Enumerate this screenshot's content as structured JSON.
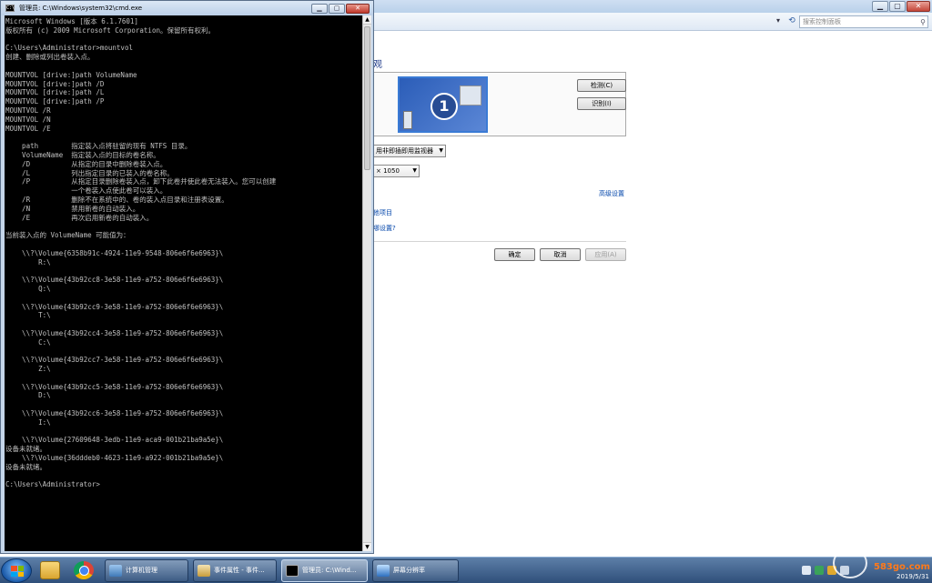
{
  "cmd_window": {
    "title": "管理员: C:\\Windows\\system32\\cmd.exe",
    "icon_label": "C:\\",
    "output_lines": [
      "Microsoft Windows [版本 6.1.7601]",
      "版权所有 (c) 2009 Microsoft Corporation。保留所有权利。",
      "",
      "C:\\Users\\Administrator>mountvol",
      "创建、删除或列出卷装入点。",
      "",
      "MOUNTVOL [drive:]path VolumeName",
      "MOUNTVOL [drive:]path /D",
      "MOUNTVOL [drive:]path /L",
      "MOUNTVOL [drive:]path /P",
      "MOUNTVOL /R",
      "MOUNTVOL /N",
      "MOUNTVOL /E",
      "",
      "    path        指定装入点将驻留的现有 NTFS 目录。",
      "    VolumeName  指定装入点的目标的卷名称。",
      "    /D          从指定的目录中删除卷装入点。",
      "    /L          列出指定目录的已装入的卷名称。",
      "    /P          从指定目录删除卷装入点，卸下此卷并使此卷无法装入。您可以创建",
      "                一个卷装入点使此卷可以装入。",
      "    /R          删除不在系统中的、卷的装入点目录和注册表设置。",
      "    /N          禁用新卷的自动装入。",
      "    /E          再次启用新卷的自动装入。",
      "",
      "当前装入点的 VolumeName 可能值为：",
      "",
      "    \\\\?\\Volume{6358b91c-4924-11e9-9548-806e6f6e6963}\\",
      "        R:\\",
      "",
      "    \\\\?\\Volume{43b92cc8-3e58-11e9-a752-806e6f6e6963}\\",
      "        Q:\\",
      "",
      "    \\\\?\\Volume{43b92cc9-3e58-11e9-a752-806e6f6e6963}\\",
      "        T:\\",
      "",
      "    \\\\?\\Volume{43b92cc4-3e58-11e9-a752-806e6f6e6963}\\",
      "        C:\\",
      "",
      "    \\\\?\\Volume{43b92cc7-3e58-11e9-a752-806e6f6e6963}\\",
      "        Z:\\",
      "",
      "    \\\\?\\Volume{43b92cc5-3e58-11e9-a752-806e6f6e6963}\\",
      "        D:\\",
      "",
      "    \\\\?\\Volume{43b92cc6-3e58-11e9-a752-806e6f6e6963}\\",
      "        I:\\",
      "",
      "    \\\\?\\Volume{27609648-3edb-11e9-aca9-001b21ba9a5e}\\",
      "设备未就绪。",
      "    \\\\?\\Volume{36dddeb0-4623-11e9-a922-001b21ba9a5e}\\",
      "设备未就绪。",
      "",
      "C:\\Users\\Administrator>"
    ]
  },
  "control_panel": {
    "search_placeholder": "搜索控制面板",
    "heading": "观",
    "monitor_number": "1",
    "detect_label": "检测(C)",
    "identify_label": "识别(I)",
    "multi_display_value": "用非即插即用监视器",
    "resolution_value": "× 1050",
    "advanced_settings_link": "高级设置",
    "link_items": "他项目",
    "link_settings": "哪设置?",
    "ok_label": "确定",
    "cancel_label": "取消",
    "apply_label": "应用(A)"
  },
  "taskbar": {
    "items": [
      {
        "label": "计算机管理",
        "icon": "computer-management-icon"
      },
      {
        "label": "事件属性 - 事件...",
        "icon": "event-viewer-icon"
      },
      {
        "label": "管理员: C:\\Wind...",
        "icon": "cmd-icon"
      },
      {
        "label": "屏幕分辨率",
        "icon": "monitor-icon"
      }
    ],
    "date": "2019/5/31"
  },
  "watermark": {
    "text": "583go.com"
  },
  "colors": {
    "console_bg": "#000000",
    "console_text": "#c0c0c0",
    "link": "#0044aa",
    "taskbar": "#2f4f7a"
  }
}
